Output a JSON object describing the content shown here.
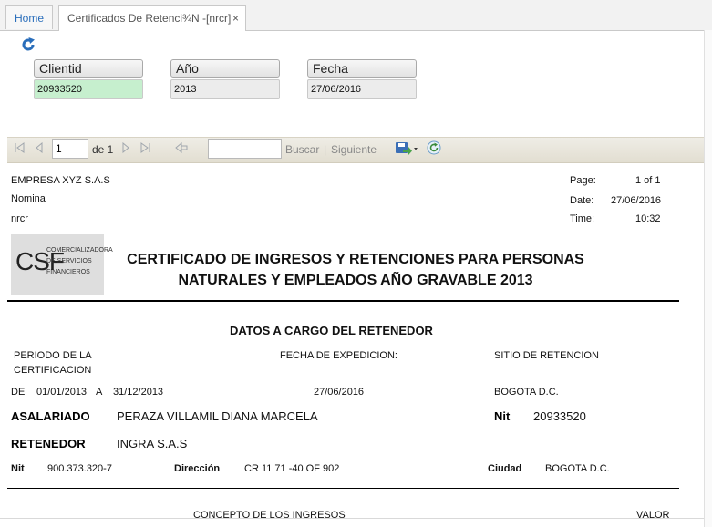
{
  "tabs": [
    {
      "label": "Home"
    },
    {
      "label": "Certificados De Retenci¾N -[nrcr]",
      "close": "×"
    }
  ],
  "params": {
    "clientid": {
      "label": "Clientid",
      "value": "20933520"
    },
    "anio": {
      "label": "Año",
      "value": "2013"
    },
    "fecha": {
      "label": "Fecha",
      "value": "27/06/2016"
    }
  },
  "toolbar": {
    "page": "1",
    "of_label": "de 1",
    "find_label": "Buscar",
    "separator": "|",
    "next_label": "Siguiente",
    "icons": [
      "first-page-icon",
      "prev-page-icon",
      "next-page-icon",
      "last-page-icon",
      "back-icon",
      "export-icon",
      "refresh-icon"
    ]
  },
  "report": {
    "company": "EMPRESA XYZ S.A.S",
    "nomina": "Nomina",
    "user": "nrcr",
    "page_label": "Page:",
    "page_value": "1 of 1",
    "date_label": "Date:",
    "date_value": "27/06/2016",
    "time_label": "Time:",
    "time_value": "10:32",
    "logo_letters": "CSF",
    "logo_text": "COMERCIALIZADORA DE SERVICIOS FINANCIEROS",
    "title_line1": "CERTIFICADO DE INGRESOS Y RETENCIONES PARA PERSONAS",
    "title_line2": "NATURALES Y EMPLEADOS AÑO GRAVABLE 2013",
    "section_title": "DATOS A CARGO DEL RETENEDOR",
    "periodo_label_1": "PERIODO DE LA",
    "periodo_label_2": "CERTIFICACION",
    "fecha_exp_label": "FECHA DE EXPEDICION:",
    "sitio_label": "SITIO DE RETENCION",
    "de_label": "DE",
    "desde": "01/01/2013",
    "a_label": "A",
    "hasta": "31/12/2013",
    "fecha_exp": "27/06/2016",
    "sitio": "BOGOTA D.C.",
    "asalariado_label": "ASALARIADO",
    "asalariado_name": "PERAZA VILLAMIL DIANA MARCELA",
    "nit_label": "Nit",
    "asalariado_nit": "20933520",
    "retenedor_label": "RETENEDOR",
    "retenedor_name": "INGRA S.A.S",
    "ret_nit_label": "Nit",
    "ret_nit": "900.373.320-7",
    "direccion_label": "Dirección",
    "direccion": "CR 11 71 -40 OF 902",
    "ciudad_label": "Ciudad",
    "ciudad": "BOGOTA D.C.",
    "concepto_label": "CONCEPTO DE LOS INGRESOS",
    "valor_label": "VALOR"
  },
  "colors": {
    "accent": "#2a6ebb",
    "highlight_input": "#c6efce"
  }
}
